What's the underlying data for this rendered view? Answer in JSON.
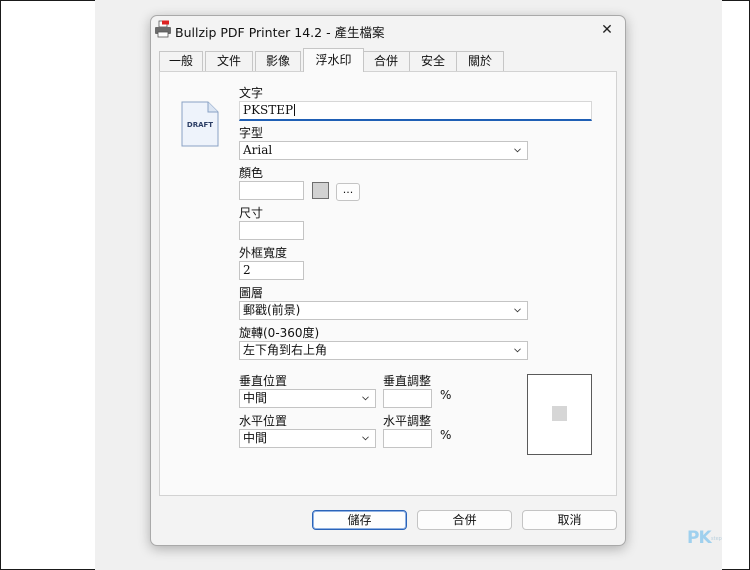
{
  "dialog": {
    "title": "Bullzip PDF Printer 14.2 - 產生檔案",
    "close_glyph": "✕"
  },
  "tabs": [
    {
      "label": "一般",
      "active": false
    },
    {
      "label": "文件",
      "active": false
    },
    {
      "label": "影像",
      "active": false
    },
    {
      "label": "浮水印",
      "active": true
    },
    {
      "label": "合併",
      "active": false
    },
    {
      "label": "安全",
      "active": false
    },
    {
      "label": "關於",
      "active": false
    }
  ],
  "watermark": {
    "icon_text": "DRAFT",
    "text_label": "文字",
    "text_value": "PKSTEP",
    "font_label": "字型",
    "font_value": "Arial",
    "color_label": "顏色",
    "color_value": "",
    "color_swatch": "#d2d2d2",
    "color_button": "...",
    "size_label": "尺寸",
    "size_value": "",
    "outline_label": "外框寬度",
    "outline_value": "2",
    "layer_label": "圖層",
    "layer_value": "郵戳(前景)",
    "rotation_label": "旋轉(0-360度)",
    "rotation_value": "左下角到右上角",
    "vpos_label": "垂直位置",
    "vpos_value": "中間",
    "vadjust_label": "垂直調整",
    "vadjust_value": "",
    "hpos_label": "水平位置",
    "hpos_value": "中間",
    "hadjust_label": "水平調整",
    "hadjust_value": "",
    "percent": "%"
  },
  "buttons": {
    "save": "儲存",
    "merge": "合併",
    "cancel": "取消"
  },
  "brand": {
    "logo": "PK",
    "sub": "step"
  },
  "colors": {
    "focus_underline": "#1f5fb5",
    "primary_button_border": "#2b63b8"
  }
}
